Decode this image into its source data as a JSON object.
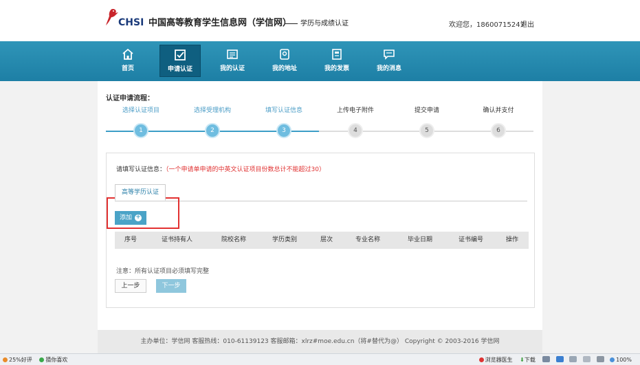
{
  "header": {
    "logo_text": "CHSI",
    "site_title": "中国高等教育学生信息网（学信网）",
    "site_subtitle": "学历与成绩认证",
    "welcome": "欢迎您，18600715247",
    "logout": "退出"
  },
  "nav": {
    "items": [
      {
        "label": "首页",
        "icon": "home-icon"
      },
      {
        "label": "申请认证",
        "icon": "checkbox-icon"
      },
      {
        "label": "我的认证",
        "icon": "certificate-icon"
      },
      {
        "label": "我的地址",
        "icon": "location-icon"
      },
      {
        "label": "我的发票",
        "icon": "invoice-icon"
      },
      {
        "label": "我的消息",
        "icon": "message-icon"
      }
    ],
    "active_index": 1
  },
  "flow": {
    "title": "认证申请流程：",
    "steps": [
      {
        "label": "选择认证项目",
        "num": "1",
        "state": "done"
      },
      {
        "label": "选择受理机构",
        "num": "2",
        "state": "done"
      },
      {
        "label": "填写认证信息",
        "num": "3",
        "state": "done"
      },
      {
        "label": "上传电子附件",
        "num": "4",
        "state": "todo"
      },
      {
        "label": "提交申请",
        "num": "5",
        "state": "todo"
      },
      {
        "label": "确认并支付",
        "num": "6",
        "state": "todo"
      }
    ]
  },
  "form": {
    "notice_prefix": "请填写认证信息：",
    "notice_red": "（一个申请单申请的中英文认证项目份数总计不能超过30）",
    "tab_label": "高等学历认证",
    "add_button": "添加",
    "table_headers": [
      "序号",
      "证书持有人",
      "院校名称",
      "学历类别",
      "层次",
      "专业名称",
      "毕业日期",
      "证书编号",
      "操作"
    ],
    "note": "注意：所有认证项目必须填写完整",
    "prev_button": "上一步",
    "next_button": "下一步"
  },
  "footer": {
    "text": "主办单位：学信网    客服热线：010-61139123    客服邮箱：xlrz#moe.edu.cn（将#替代为@）    Copyright © 2003-2016 学信网"
  },
  "statusbar": {
    "left": [
      "25%好评",
      "猜你喜欢"
    ],
    "doctor": "浏览器医生",
    "download": "下载",
    "zoom": "100%"
  },
  "colors": {
    "nav_bg": "#2589b0",
    "accent": "#4aa3c7",
    "highlight_box": "#e23030",
    "notice_red": "#e03030"
  }
}
